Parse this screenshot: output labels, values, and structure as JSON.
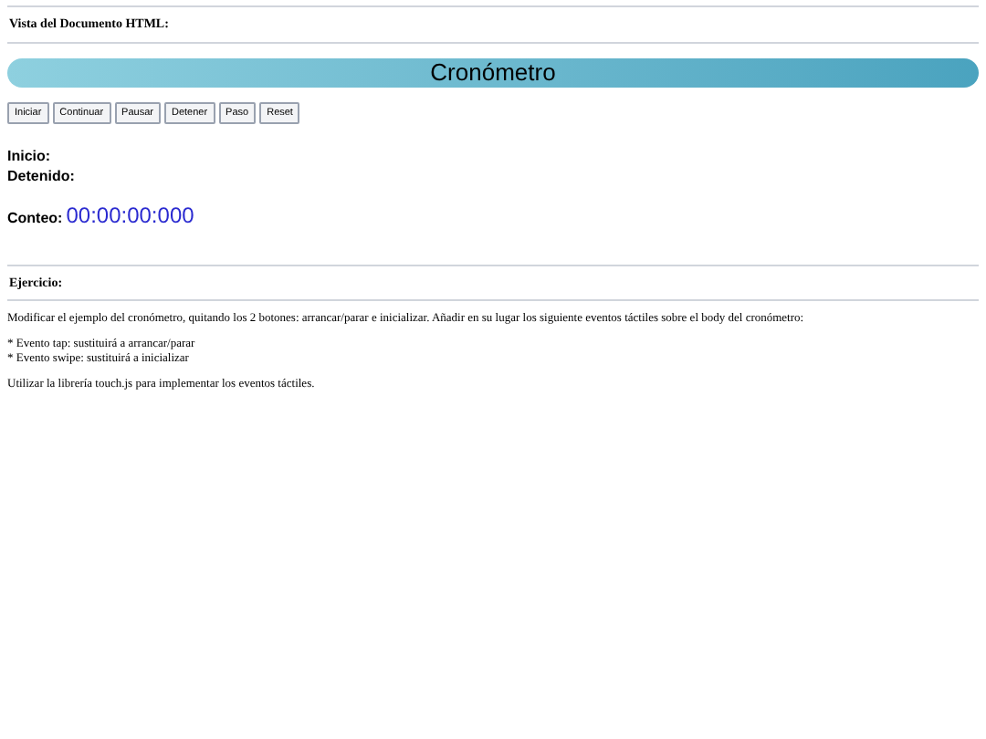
{
  "preview_heading": "Vista del Documento HTML:",
  "stopwatch": {
    "title": "Cronómetro",
    "buttons": [
      "Iniciar",
      "Continuar",
      "Pausar",
      "Detener",
      "Paso",
      "Reset"
    ],
    "start_label": "Inicio:",
    "stopped_label": "Detenido:",
    "count_label": "Conteo:",
    "count_value": "00:00:00:000"
  },
  "exercise": {
    "heading": "Ejercicio:",
    "intro": "Modificar el ejemplo del cronómetro, quitando los 2 botones: arrancar/parar e inicializar. Añadir en su lugar los siguiente eventos táctiles sobre el body del cronómetro:",
    "events": [
      "* Evento tap: sustituirá a arrancar/parar",
      "* Evento swipe: sustituirá a inicializar"
    ],
    "note": "Utilizar la librería touch.js para implementar los eventos táctiles."
  }
}
